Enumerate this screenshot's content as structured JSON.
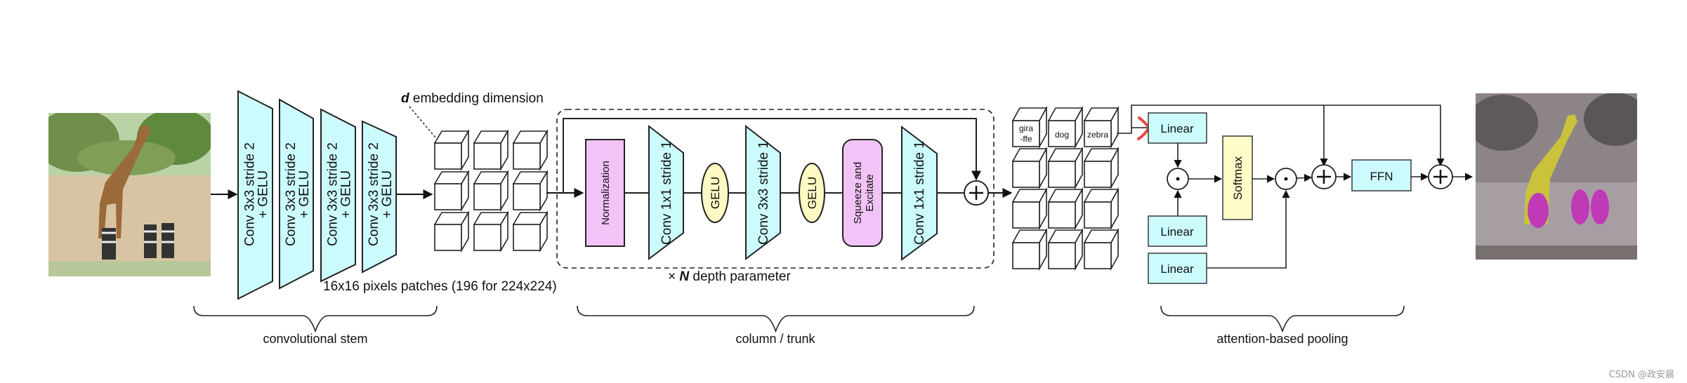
{
  "input_image": {
    "alt": "giraffe and zebras photo"
  },
  "output_image": {
    "alt": "attention map over giraffe and zebras"
  },
  "stem": {
    "layers": [
      {
        "line1": "Conv 3x3 stride 2",
        "line2": "+ GELU"
      },
      {
        "line1": "Conv 3x3 stride 2",
        "line2": "+ GELU"
      },
      {
        "line1": "Conv 3x3 stride 2",
        "line2": "+ GELU"
      },
      {
        "line1": "Conv 3x3 stride 2",
        "line2": "+ GELU"
      }
    ],
    "embedding_label_var": "d",
    "embedding_label_text": " embedding dimension",
    "patches_label": "16x16 pixels patches (196 for 224x224)",
    "brace_label": "convolutional stem"
  },
  "trunk": {
    "normalization": "Normalization",
    "conv1": "Conv 1x1 stride 1",
    "gelu1": "GELU",
    "conv2": "Conv 3x3 stride 1",
    "gelu2": "GELU",
    "se_line1": "Squeeze and",
    "se_line2": "Excitate",
    "conv3": "Conv 1x1 stride 1",
    "repeat_prefix": "× ",
    "repeat_var": "N",
    "repeat_text": " depth parameter",
    "brace_label": "column / trunk"
  },
  "pooling": {
    "class_tokens": [
      {
        "line1": "gira",
        "line2": "-ffe"
      },
      {
        "line1": "dog",
        "line2": ""
      },
      {
        "line1": "zebra",
        "line2": ""
      }
    ],
    "linear_q": "Linear",
    "linear_k": "Linear",
    "linear_v": "Linear",
    "softmax": "Softmax",
    "ffn": "FFN",
    "brace_label": "attention-based pooling"
  },
  "watermark": "CSDN @政安晨",
  "colors": {
    "conv_fill": "#ccfbfe",
    "norm_fill": "#f2c3f7",
    "gelu_fill": "#fff9c4",
    "softmax_fill": "#fffdc8",
    "annotation_red": "#e8463f"
  }
}
